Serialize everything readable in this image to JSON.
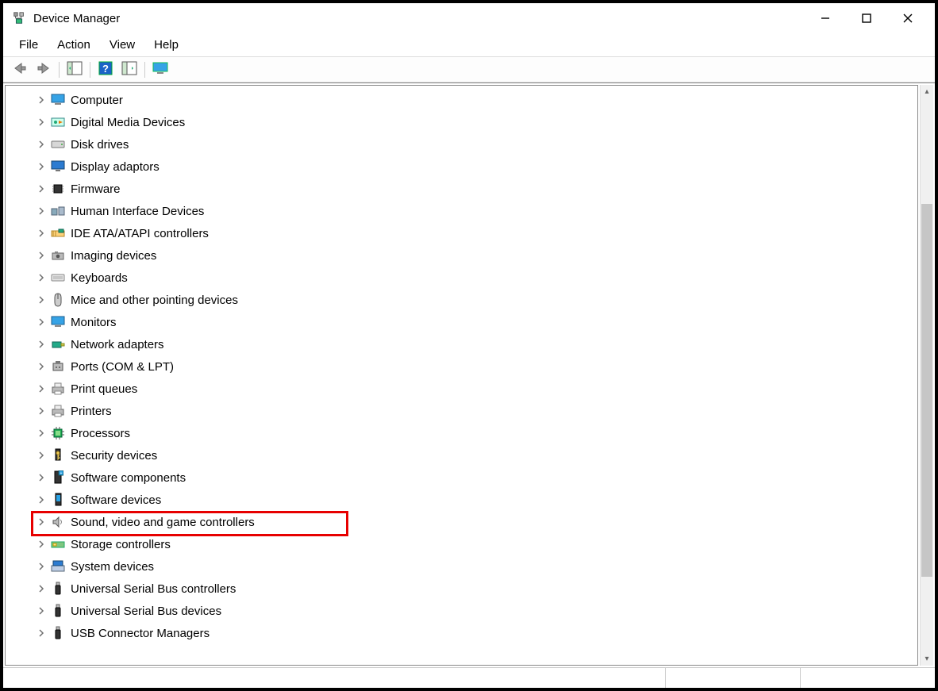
{
  "window": {
    "title": "Device Manager"
  },
  "menu": {
    "items": [
      "File",
      "Action",
      "View",
      "Help"
    ]
  },
  "toolbar": {
    "buttons": [
      {
        "name": "nav-back-icon"
      },
      {
        "name": "nav-forward-icon"
      },
      {
        "name": "show-hide-tree-icon"
      },
      {
        "name": "help-icon"
      },
      {
        "name": "scan-hardware-icon"
      },
      {
        "name": "display-devices-icon"
      }
    ]
  },
  "tree": {
    "nodes": [
      {
        "label": "Computer",
        "icon": "monitor",
        "highlighted": false
      },
      {
        "label": "Digital Media Devices",
        "icon": "media",
        "highlighted": false
      },
      {
        "label": "Disk drives",
        "icon": "disk",
        "highlighted": false
      },
      {
        "label": "Display adaptors",
        "icon": "display",
        "highlighted": false
      },
      {
        "label": "Firmware",
        "icon": "chip",
        "highlighted": false
      },
      {
        "label": "Human Interface Devices",
        "icon": "hid",
        "highlighted": false
      },
      {
        "label": "IDE ATA/ATAPI controllers",
        "icon": "ide",
        "highlighted": false
      },
      {
        "label": "Imaging devices",
        "icon": "camera",
        "highlighted": false
      },
      {
        "label": "Keyboards",
        "icon": "keyboard",
        "highlighted": false
      },
      {
        "label": "Mice and other pointing devices",
        "icon": "mouse",
        "highlighted": false
      },
      {
        "label": "Monitors",
        "icon": "monitor",
        "highlighted": false
      },
      {
        "label": "Network adapters",
        "icon": "network",
        "highlighted": false
      },
      {
        "label": "Ports (COM & LPT)",
        "icon": "port",
        "highlighted": false
      },
      {
        "label": "Print queues",
        "icon": "printer",
        "highlighted": false
      },
      {
        "label": "Printers",
        "icon": "printer",
        "highlighted": false
      },
      {
        "label": "Processors",
        "icon": "cpu",
        "highlighted": false
      },
      {
        "label": "Security devices",
        "icon": "security",
        "highlighted": false
      },
      {
        "label": "Software components",
        "icon": "swcomp",
        "highlighted": false
      },
      {
        "label": "Software devices",
        "icon": "swdev",
        "highlighted": false
      },
      {
        "label": "Sound, video and game controllers",
        "icon": "sound",
        "highlighted": true
      },
      {
        "label": "Storage controllers",
        "icon": "storage",
        "highlighted": false
      },
      {
        "label": "System devices",
        "icon": "system",
        "highlighted": false
      },
      {
        "label": "Universal Serial Bus controllers",
        "icon": "usb",
        "highlighted": false
      },
      {
        "label": "Universal Serial Bus devices",
        "icon": "usb",
        "highlighted": false
      },
      {
        "label": "USB Connector Managers",
        "icon": "usb",
        "highlighted": false
      }
    ]
  }
}
